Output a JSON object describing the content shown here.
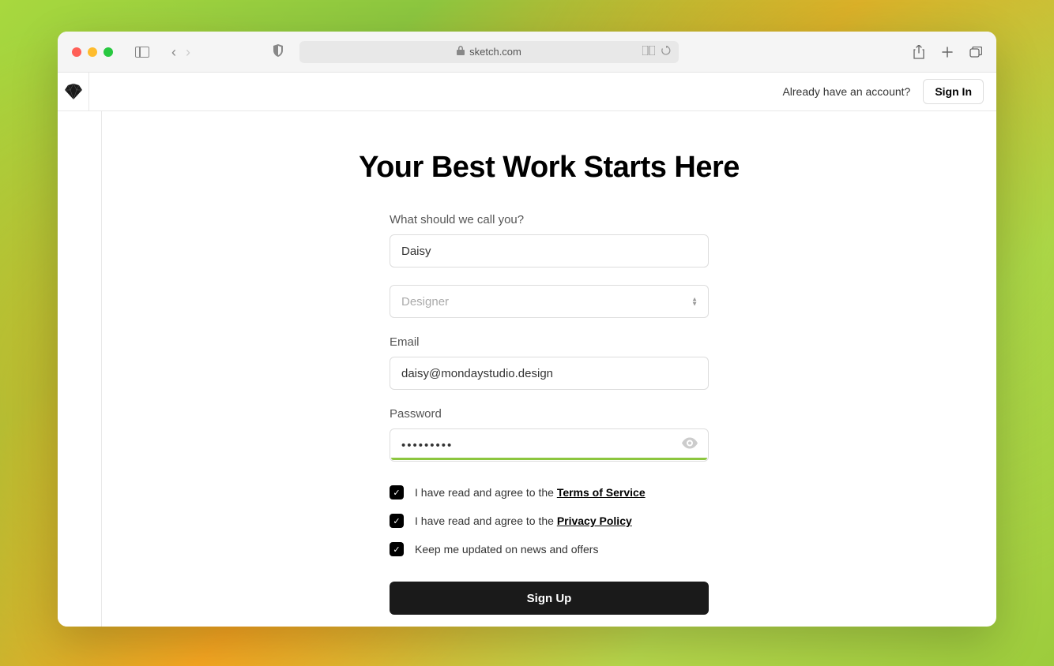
{
  "browser": {
    "url": "sketch.com"
  },
  "header": {
    "already_text": "Already have an account?",
    "signin_label": "Sign In"
  },
  "page": {
    "title": "Your Best Work Starts Here"
  },
  "form": {
    "name": {
      "label": "What should we call you?",
      "value": "Daisy"
    },
    "role": {
      "placeholder": "Designer"
    },
    "email": {
      "label": "Email",
      "value": "daisy@mondaystudio.design"
    },
    "password": {
      "label": "Password",
      "value": "•••••••••"
    },
    "checkboxes": {
      "tos_prefix": "I have read and agree to the ",
      "tos_link": "Terms of Service",
      "privacy_prefix": "I have read and agree to the ",
      "privacy_link": "Privacy Policy",
      "news_label": "Keep me updated on news and offers"
    },
    "submit_label": "Sign Up"
  }
}
